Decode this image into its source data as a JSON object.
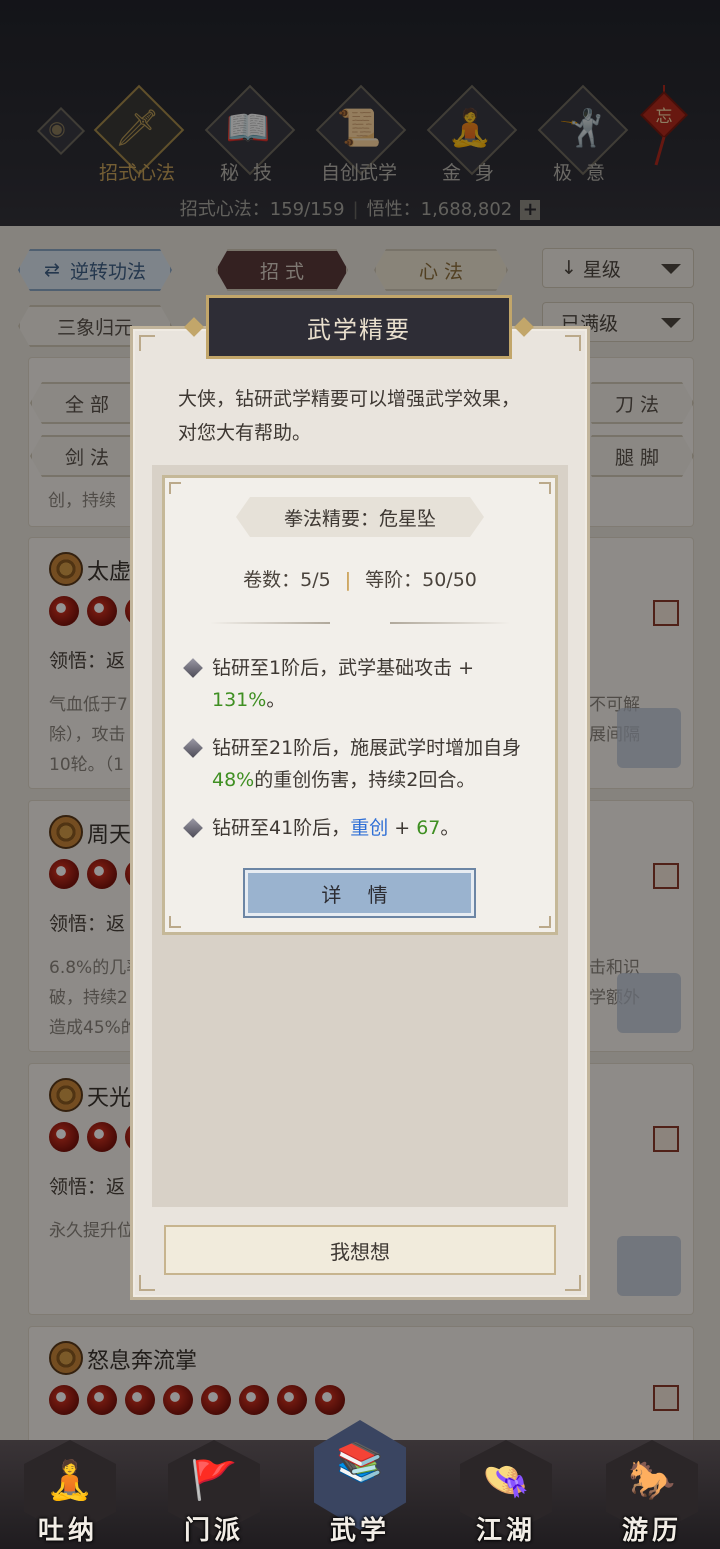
{
  "header": {
    "tabs": [
      {
        "label": "招式心法",
        "icon": "sword-icon",
        "active": true
      },
      {
        "label": "秘 技",
        "icon": "book-icon",
        "active": false
      },
      {
        "label": "自创武学",
        "icon": "scroll-icon",
        "active": false
      },
      {
        "label": "金 身",
        "icon": "meditation-icon",
        "active": false
      },
      {
        "label": "极 意",
        "icon": "martial-pose-icon",
        "active": false
      }
    ],
    "knot_char": "忘",
    "stats_moves": "招式心法：159/159",
    "stats_insight": "悟性：1,688,802"
  },
  "toolbar": {
    "reverse_label": "逆转功法",
    "tab_moves": "招 式",
    "tab_methods": "心 法",
    "sort_select": "星级",
    "filter_select": "已满级",
    "school_button": "三象归元"
  },
  "categories": [
    "全 部",
    "刀 法",
    "剑 法",
    "腿 脚"
  ],
  "cards": [
    {
      "title": "太虚",
      "lead": "领悟：返",
      "desc1": "气血低于7",
      "desc2": "除），攻击",
      "desc3": "10轮。（1",
      "right1": "不可解",
      "right2": "展间隔",
      "prev": "创，持续"
    },
    {
      "title": "周天",
      "lead": "领悟：返",
      "desc1": "6.8%的几率",
      "desc2": "破，持续2",
      "desc3": "造成45%的",
      "right1": "击和识",
      "right2": "学额外"
    },
    {
      "title": "天光",
      "lead": "领悟：返",
      "desc1": "永久提升位"
    },
    {
      "title": "怒息奔流掌"
    }
  ],
  "modal": {
    "title": "武学精要",
    "intro": "大侠，钻研武学精要可以增强武学效果，对您大有帮助。",
    "banner": "拳法精要：危星坠",
    "volumes": "卷数：5/5",
    "rank": "等阶：50/50",
    "bullet1_text": "钻研至1阶后，武学基础攻击 +",
    "bullet1_value": "131%",
    "bullet1_end": "。",
    "bullet2_a": "钻研至21阶后，施展武学时增加自身",
    "bullet2_value": "48%",
    "bullet2_b": "的重创伤害，持续2回合。",
    "bullet3_a": "钻研至41阶后，",
    "bullet3_link": "重创",
    "bullet3_b": " + ",
    "bullet3_value": "67",
    "bullet3_end": "。",
    "detail_button": "详 情",
    "think_button": "我想想"
  },
  "bottom_nav": [
    {
      "label": "吐纳",
      "icon": "meditation-icon"
    },
    {
      "label": "门派",
      "icon": "flags-icon"
    },
    {
      "label": "武学",
      "icon": "books-icon",
      "active": true
    },
    {
      "label": "江湖",
      "icon": "straw-hat-icon"
    },
    {
      "label": "游历",
      "icon": "horse-icon"
    }
  ],
  "colors": {
    "accent_gold": "#c2a66a",
    "green_value": "#3f8f22",
    "blue_link": "#2f6fd6"
  }
}
